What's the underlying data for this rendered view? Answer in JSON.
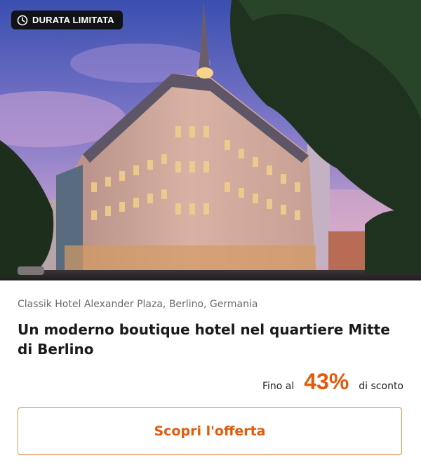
{
  "badge": {
    "label": "DURATA LIMITATA",
    "icon": "clock-icon"
  },
  "hotel": {
    "location": "Classik Hotel Alexander Plaza, Berlino, Germania",
    "title": "Un moderno boutique hotel nel quartiere Mitte di Berlino"
  },
  "offer": {
    "prefix": "Fino al",
    "percent": "43%",
    "suffix": "di sconto"
  },
  "cta": {
    "label": "Scopri l'offerta"
  },
  "colors": {
    "accent": "#e35a0d",
    "badge_bg": "#111317",
    "cta_border": "#e8904f"
  }
}
